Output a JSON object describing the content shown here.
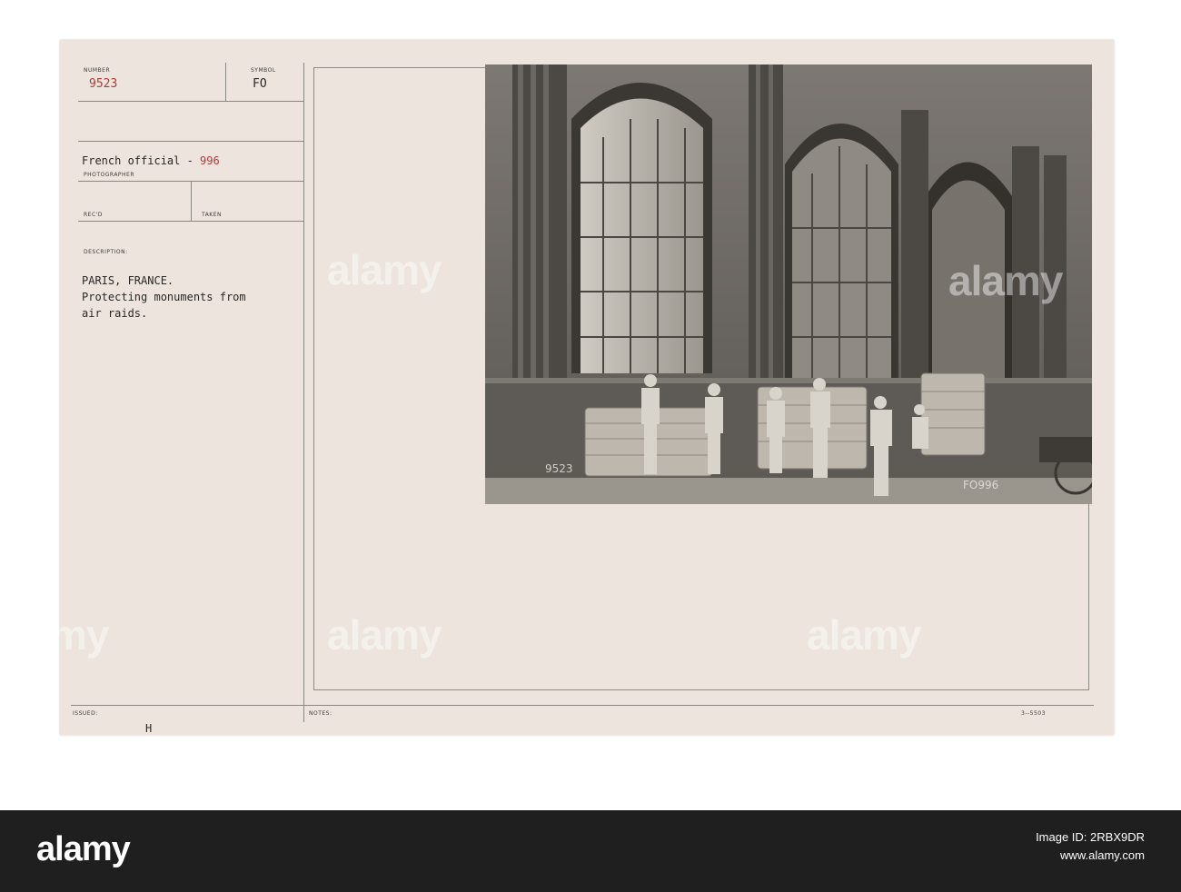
{
  "card": {
    "number_label": "NUMBER",
    "number_value": "9523",
    "symbol_label": "SYMBOL",
    "symbol_value": "FO",
    "photographer_value_a": "French official - ",
    "photographer_value_b": "996",
    "photographer_label": "PHOTOGRAPHER",
    "recd_label": "REC'D",
    "taken_label": "TAKEN",
    "description_label": "DESCRIPTION:",
    "description_line1": "PARIS, FRANCE.",
    "description_line2": "Protecting monuments from",
    "description_line3": "air raids.",
    "issued_label": "ISSUED:",
    "issued_value": "H",
    "notes_label": "NOTES:",
    "form_number": "3--5503"
  },
  "photo": {
    "caption_left": "9523",
    "caption_right": "FO996"
  },
  "watermark": {
    "text": "alamy",
    "colors": {
      "card": "#ece4dd",
      "footer": "#1f1f1f",
      "red_type": "#b33a3a"
    }
  },
  "footer": {
    "logo": "alamy",
    "image_id": "Image ID: 2RBX9DR",
    "url": "www.alamy.com"
  }
}
